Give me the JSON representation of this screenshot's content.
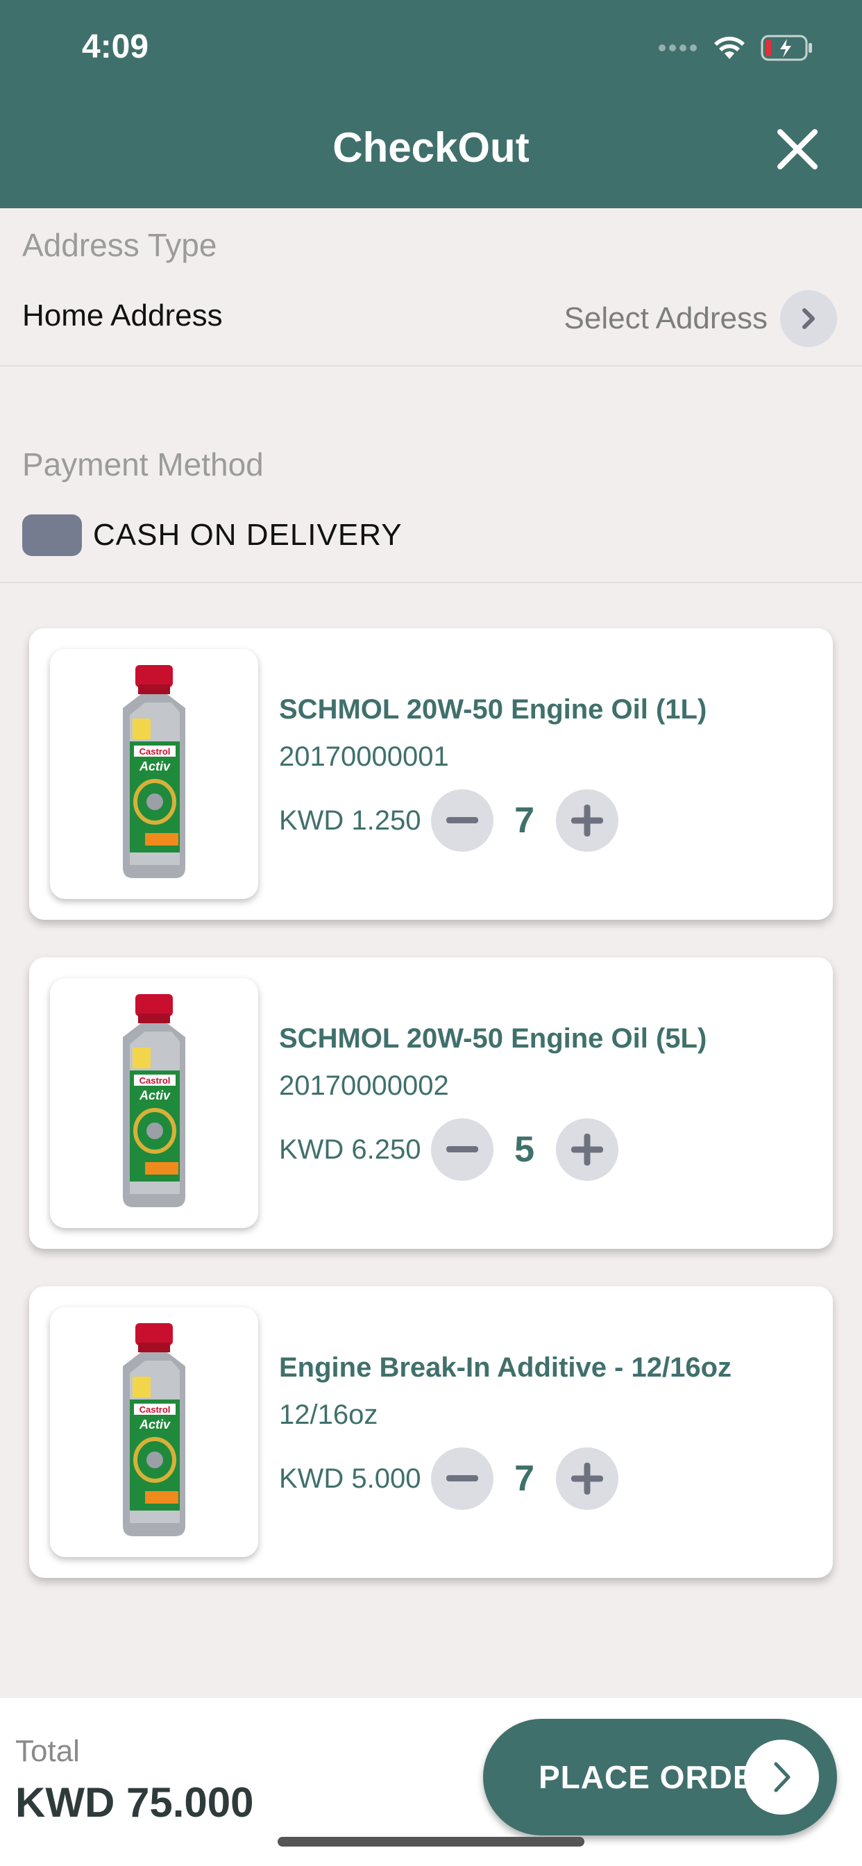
{
  "status_bar": {
    "time": "4:09"
  },
  "header": {
    "title": "CheckOut"
  },
  "address": {
    "label": "Address Type",
    "value": "Home Address",
    "select_label": "Select Address"
  },
  "payment": {
    "label": "Payment Method",
    "option": "CASH ON DELIVERY"
  },
  "cart": {
    "items": [
      {
        "name": "SCHMOL 20W-50 Engine Oil (1L)",
        "sku": "20170000001",
        "price": "KWD 1.250",
        "qty": "7"
      },
      {
        "name": "SCHMOL 20W-50 Engine Oil (5L)",
        "sku": "20170000002",
        "price": "KWD 6.250",
        "qty": "5"
      },
      {
        "name": "Engine Break-In Additive - 12/16oz",
        "sku": "12/16oz",
        "price": "KWD 5.000",
        "qty": "7"
      }
    ]
  },
  "footer": {
    "total_label": "Total",
    "total_value": "KWD 75.000",
    "place_order_label": "PLACE ORDER"
  },
  "colors": {
    "brand": "#40706b",
    "background": "#f3eeee",
    "button_gray": "#dcdde2"
  }
}
